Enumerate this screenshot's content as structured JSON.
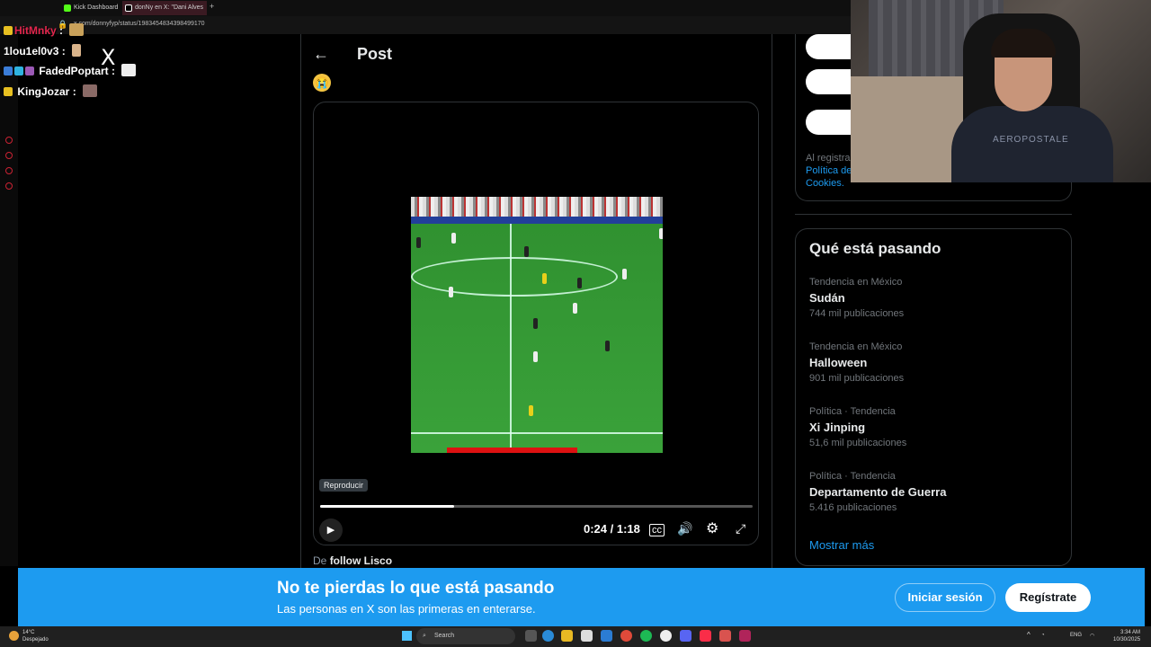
{
  "browser": {
    "tabs": [
      {
        "label": "Kick Dashboard"
      },
      {
        "label": "donNy en X: \"Dani Alves"
      }
    ],
    "url": "x.com/donnyfyp/status/1983454834398499170"
  },
  "chat": {
    "lines": [
      {
        "user": "HitMnky",
        "text": ":"
      },
      {
        "user": "1lou1el0v3",
        "text": ":"
      },
      {
        "user": "FadedPoptart",
        "text": ":"
      },
      {
        "user": "KingJozar",
        "text": ":"
      }
    ],
    "x_logo": "X"
  },
  "post": {
    "header_title": "Post",
    "back_icon": "arrow-left-icon",
    "emoji": "😭",
    "video": {
      "tooltip": "Reproducir",
      "time": "0:24 / 1:18",
      "progress": 0.31
    },
    "from_prefix": "De",
    "from_name": "follow Lisco"
  },
  "sidebar": {
    "fineprint": {
      "text": "Al registrar",
      "link1": "Política de",
      "link2": "Cookies."
    },
    "trends_title": "Qué está pasando",
    "trends": [
      {
        "context": "Tendencia en México",
        "name": "Sudán",
        "count": "744 mil publicaciones"
      },
      {
        "context": "Tendencia en México",
        "name": "Halloween",
        "count": "901 mil publicaciones"
      },
      {
        "context": "Política · Tendencia",
        "name": "Xi Jinping",
        "count": "51,6 mil publicaciones"
      },
      {
        "context": "Política · Tendencia",
        "name": "Departamento de Guerra",
        "count": "5.416 publicaciones"
      }
    ],
    "show_more": "Mostrar más"
  },
  "webcam": {
    "shirt_text": "AEROPOSTALE"
  },
  "promo": {
    "heading": "No te pierdas lo que está pasando",
    "subheading": "Las personas en X son las primeras en enterarse.",
    "login_label": "Iniciar sesión",
    "signup_label": "Regístrate"
  },
  "taskbar": {
    "weather_temp": "14°C",
    "weather_desc": "Despejado",
    "search_label": "Search",
    "language": "ENG",
    "time": "3:34 AM",
    "date": "10/30/2025"
  },
  "colors": {
    "accent": "#1d9bf0",
    "background": "#000000",
    "border": "#2f3336"
  }
}
